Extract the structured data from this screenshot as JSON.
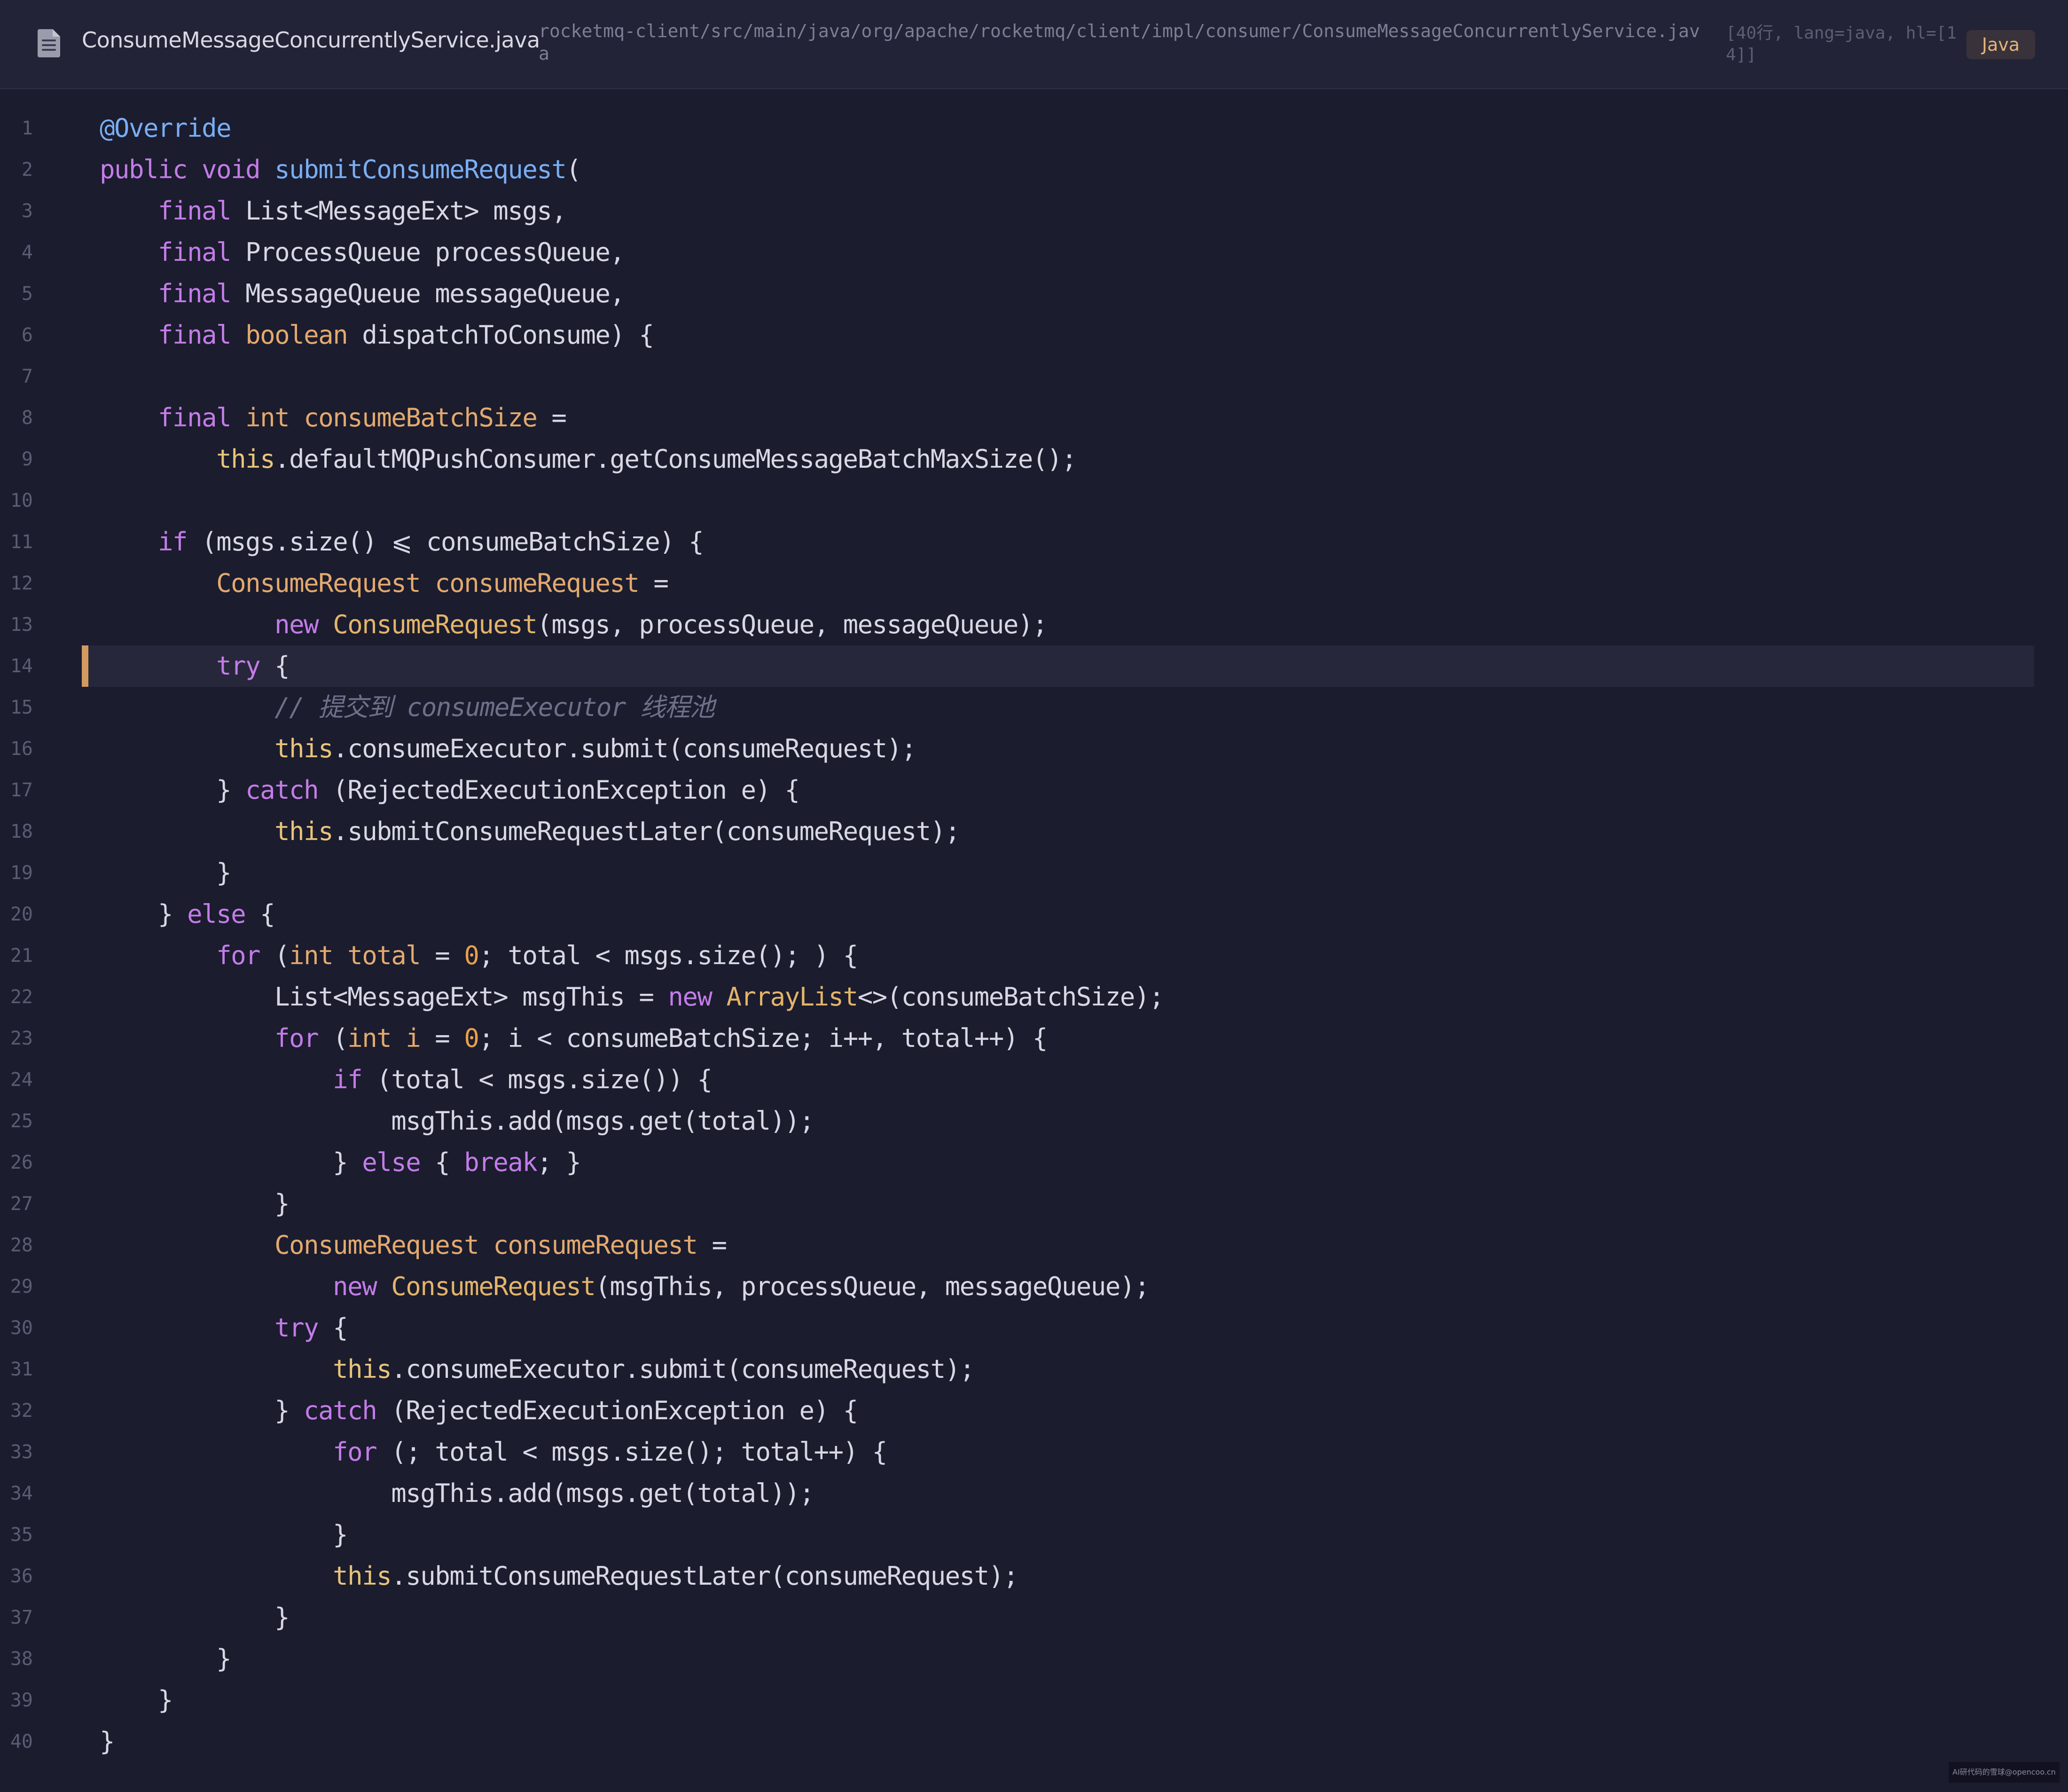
{
  "header": {
    "file_icon": "file-icon",
    "file_name": "ConsumeMessageConcurrentlyService.java",
    "file_path": "rocketmq-client/src/main/java/org/apache/rocketmq/client/impl/consumer/ConsumeMessageConcurrentlyService.java",
    "meta": "[40行, lang=java, hl=[14]]",
    "language_badge": "Java"
  },
  "colors": {
    "background": "#1b1c2e",
    "header_background": "#222336",
    "keyword": "#c37ce8",
    "type": "#e3a96e",
    "function": "#79aef4",
    "this": "#e8c47a",
    "number": "#e8a04c",
    "comment": "#6e7089",
    "text": "#d7d8e3",
    "highlight_bar": "#d39a5f"
  },
  "highlighted_lines": [
    14
  ],
  "code_lines": [
    {
      "num": "1",
      "tokens": [
        [
          "ann",
          "@Override"
        ]
      ]
    },
    {
      "num": "2",
      "tokens": [
        [
          "kw",
          "public"
        ],
        [
          "txt",
          " "
        ],
        [
          "kw",
          "void"
        ],
        [
          "txt",
          " "
        ],
        [
          "fn",
          "submitConsumeRequest"
        ],
        [
          "txt",
          "("
        ]
      ]
    },
    {
      "num": "3",
      "tokens": [
        [
          "txt",
          "    "
        ],
        [
          "kw",
          "final"
        ],
        [
          "txt",
          " List<MessageExt> msgs,"
        ]
      ]
    },
    {
      "num": "4",
      "tokens": [
        [
          "txt",
          "    "
        ],
        [
          "kw",
          "final"
        ],
        [
          "txt",
          " ProcessQueue processQueue,"
        ]
      ]
    },
    {
      "num": "5",
      "tokens": [
        [
          "txt",
          "    "
        ],
        [
          "kw",
          "final"
        ],
        [
          "txt",
          " MessageQueue messageQueue,"
        ]
      ]
    },
    {
      "num": "6",
      "tokens": [
        [
          "txt",
          "    "
        ],
        [
          "kw",
          "final"
        ],
        [
          "txt",
          " "
        ],
        [
          "type",
          "boolean"
        ],
        [
          "txt",
          " dispatchToConsume) {"
        ]
      ]
    },
    {
      "num": "7",
      "tokens": []
    },
    {
      "num": "8",
      "tokens": [
        [
          "txt",
          "    "
        ],
        [
          "kw",
          "final"
        ],
        [
          "txt",
          " "
        ],
        [
          "type",
          "int"
        ],
        [
          "txt",
          " "
        ],
        [
          "type",
          "consumeBatchSize"
        ],
        [
          "txt",
          " ="
        ]
      ]
    },
    {
      "num": "9",
      "tokens": [
        [
          "txt",
          "        "
        ],
        [
          "this",
          "this"
        ],
        [
          "txt",
          ".defaultMQPushConsumer.getConsumeMessageBatchMaxSize();"
        ]
      ]
    },
    {
      "num": "10",
      "tokens": []
    },
    {
      "num": "11",
      "tokens": [
        [
          "txt",
          "    "
        ],
        [
          "kw",
          "if"
        ],
        [
          "txt",
          " (msgs.size() ⩽ consumeBatchSize) {"
        ]
      ]
    },
    {
      "num": "12",
      "tokens": [
        [
          "txt",
          "        "
        ],
        [
          "type",
          "ConsumeRequest"
        ],
        [
          "txt",
          " "
        ],
        [
          "type",
          "consumeRequest"
        ],
        [
          "txt",
          " ="
        ]
      ]
    },
    {
      "num": "13",
      "tokens": [
        [
          "txt",
          "            "
        ],
        [
          "kw",
          "new"
        ],
        [
          "txt",
          " "
        ],
        [
          "cls",
          "ConsumeRequest"
        ],
        [
          "txt",
          "(msgs, processQueue, messageQueue);"
        ]
      ]
    },
    {
      "num": "14",
      "tokens": [
        [
          "txt",
          "        "
        ],
        [
          "kw",
          "try"
        ],
        [
          "txt",
          " {"
        ]
      ]
    },
    {
      "num": "15",
      "tokens": [
        [
          "txt",
          "            "
        ],
        [
          "cmt",
          "// 提交到 consumeExecutor 线程池"
        ]
      ]
    },
    {
      "num": "16",
      "tokens": [
        [
          "txt",
          "            "
        ],
        [
          "this",
          "this"
        ],
        [
          "txt",
          ".consumeExecutor.submit(consumeRequest);"
        ]
      ]
    },
    {
      "num": "17",
      "tokens": [
        [
          "txt",
          "        } "
        ],
        [
          "kw",
          "catch"
        ],
        [
          "txt",
          " (RejectedExecutionException e) {"
        ]
      ]
    },
    {
      "num": "18",
      "tokens": [
        [
          "txt",
          "            "
        ],
        [
          "this",
          "this"
        ],
        [
          "txt",
          ".submitConsumeRequestLater(consumeRequest);"
        ]
      ]
    },
    {
      "num": "19",
      "tokens": [
        [
          "txt",
          "        }"
        ]
      ]
    },
    {
      "num": "20",
      "tokens": [
        [
          "txt",
          "    } "
        ],
        [
          "kw",
          "else"
        ],
        [
          "txt",
          " {"
        ]
      ]
    },
    {
      "num": "21",
      "tokens": [
        [
          "txt",
          "        "
        ],
        [
          "kw",
          "for"
        ],
        [
          "txt",
          " ("
        ],
        [
          "type",
          "int"
        ],
        [
          "txt",
          " "
        ],
        [
          "type",
          "total"
        ],
        [
          "txt",
          " = "
        ],
        [
          "num",
          "0"
        ],
        [
          "txt",
          "; total < msgs.size(); ) {"
        ]
      ]
    },
    {
      "num": "22",
      "tokens": [
        [
          "txt",
          "            List<MessageExt> msgThis = "
        ],
        [
          "kw",
          "new"
        ],
        [
          "txt",
          " "
        ],
        [
          "cls",
          "ArrayList"
        ],
        [
          "txt",
          "<>(consumeBatchSize);"
        ]
      ]
    },
    {
      "num": "23",
      "tokens": [
        [
          "txt",
          "            "
        ],
        [
          "kw",
          "for"
        ],
        [
          "txt",
          " ("
        ],
        [
          "type",
          "int"
        ],
        [
          "txt",
          " "
        ],
        [
          "type",
          "i"
        ],
        [
          "txt",
          " = "
        ],
        [
          "num",
          "0"
        ],
        [
          "txt",
          "; i < consumeBatchSize; i++, total++) {"
        ]
      ]
    },
    {
      "num": "24",
      "tokens": [
        [
          "txt",
          "                "
        ],
        [
          "kw",
          "if"
        ],
        [
          "txt",
          " (total < msgs.size()) {"
        ]
      ]
    },
    {
      "num": "25",
      "tokens": [
        [
          "txt",
          "                    msgThis.add(msgs.get(total));"
        ]
      ]
    },
    {
      "num": "26",
      "tokens": [
        [
          "txt",
          "                } "
        ],
        [
          "kw",
          "else"
        ],
        [
          "txt",
          " { "
        ],
        [
          "kw",
          "break"
        ],
        [
          "txt",
          "; }"
        ]
      ]
    },
    {
      "num": "27",
      "tokens": [
        [
          "txt",
          "            }"
        ]
      ]
    },
    {
      "num": "28",
      "tokens": [
        [
          "txt",
          "            "
        ],
        [
          "type",
          "ConsumeRequest"
        ],
        [
          "txt",
          " "
        ],
        [
          "type",
          "consumeRequest"
        ],
        [
          "txt",
          " ="
        ]
      ]
    },
    {
      "num": "29",
      "tokens": [
        [
          "txt",
          "                "
        ],
        [
          "kw",
          "new"
        ],
        [
          "txt",
          " "
        ],
        [
          "cls",
          "ConsumeRequest"
        ],
        [
          "txt",
          "(msgThis, processQueue, messageQueue);"
        ]
      ]
    },
    {
      "num": "30",
      "tokens": [
        [
          "txt",
          "            "
        ],
        [
          "kw",
          "try"
        ],
        [
          "txt",
          " {"
        ]
      ]
    },
    {
      "num": "31",
      "tokens": [
        [
          "txt",
          "                "
        ],
        [
          "this",
          "this"
        ],
        [
          "txt",
          ".consumeExecutor.submit(consumeRequest);"
        ]
      ]
    },
    {
      "num": "32",
      "tokens": [
        [
          "txt",
          "            } "
        ],
        [
          "kw",
          "catch"
        ],
        [
          "txt",
          " (RejectedExecutionException e) {"
        ]
      ]
    },
    {
      "num": "33",
      "tokens": [
        [
          "txt",
          "                "
        ],
        [
          "kw",
          "for"
        ],
        [
          "txt",
          " (; total < msgs.size(); total++) {"
        ]
      ]
    },
    {
      "num": "34",
      "tokens": [
        [
          "txt",
          "                    msgThis.add(msgs.get(total));"
        ]
      ]
    },
    {
      "num": "35",
      "tokens": [
        [
          "txt",
          "                }"
        ]
      ]
    },
    {
      "num": "36",
      "tokens": [
        [
          "txt",
          "                "
        ],
        [
          "this",
          "this"
        ],
        [
          "txt",
          ".submitConsumeRequestLater(consumeRequest);"
        ]
      ]
    },
    {
      "num": "37",
      "tokens": [
        [
          "txt",
          "            }"
        ]
      ]
    },
    {
      "num": "38",
      "tokens": [
        [
          "txt",
          "        }"
        ]
      ]
    },
    {
      "num": "39",
      "tokens": [
        [
          "txt",
          "    }"
        ]
      ]
    },
    {
      "num": "40",
      "tokens": [
        [
          "txt",
          "}"
        ]
      ]
    }
  ],
  "watermark": "AI研代码的雪球@opencoo.cn"
}
